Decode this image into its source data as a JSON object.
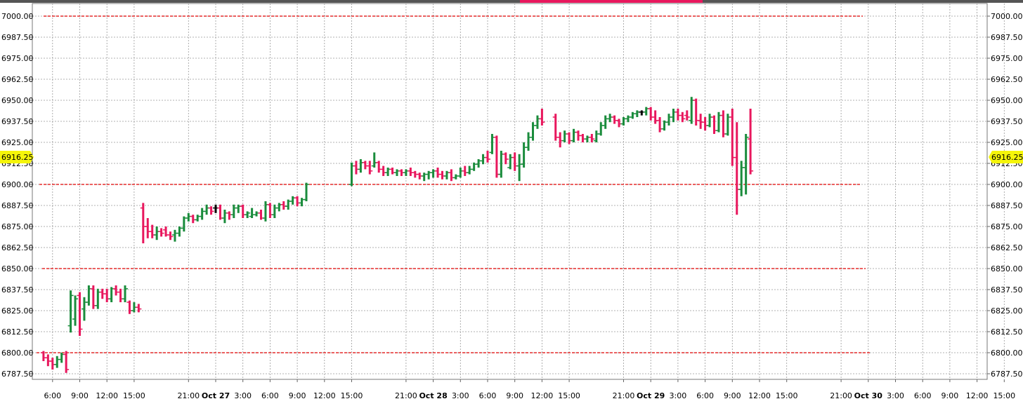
{
  "chart_data": {
    "type": "ohlc",
    "y_ticks": [
      "7000.00",
      "6987.50",
      "6975.00",
      "6962.50",
      "6950.00",
      "6937.50",
      "6925.00",
      "6912.50",
      "6900.00",
      "6887.50",
      "6875.00",
      "6862.50",
      "6850.00",
      "6837.50",
      "6825.00",
      "6812.50",
      "6800.00",
      "6787.50"
    ],
    "ylim": [
      6781,
      7004
    ],
    "x_tick_labels": [
      {
        "label": "6:00",
        "bold": false
      },
      {
        "label": "9:00",
        "bold": false
      },
      {
        "label": "12:00",
        "bold": false
      },
      {
        "label": "15:00",
        "bold": false
      },
      {
        "label": "21:00",
        "bold": false
      },
      {
        "label": "Oct 27",
        "bold": true
      },
      {
        "label": "3:00",
        "bold": false
      },
      {
        "label": "6:00",
        "bold": false
      },
      {
        "label": "9:00",
        "bold": false
      },
      {
        "label": "12:00",
        "bold": false
      },
      {
        "label": "15:00",
        "bold": false
      },
      {
        "label": "21:00",
        "bold": false
      },
      {
        "label": "Oct 28",
        "bold": true
      },
      {
        "label": "3:00",
        "bold": false
      },
      {
        "label": "6:00",
        "bold": false
      },
      {
        "label": "9:00",
        "bold": false
      },
      {
        "label": "12:00",
        "bold": false
      },
      {
        "label": "15:00",
        "bold": false
      },
      {
        "label": "21:00",
        "bold": false
      },
      {
        "label": "Oct 29",
        "bold": true
      },
      {
        "label": "3:00",
        "bold": false
      },
      {
        "label": "6:00",
        "bold": false
      },
      {
        "label": "9:00",
        "bold": false
      },
      {
        "label": "12:00",
        "bold": false
      },
      {
        "label": "15:00",
        "bold": false
      },
      {
        "label": "21:00",
        "bold": false
      },
      {
        "label": "Oct 30",
        "bold": true
      },
      {
        "label": "3:00",
        "bold": false
      },
      {
        "label": "6:00",
        "bold": false
      },
      {
        "label": "9:00",
        "bold": false
      },
      {
        "label": "12:00",
        "bold": false
      },
      {
        "label": "15:00",
        "bold": false
      }
    ],
    "current_price": "6916.25",
    "horizontal_levels": [
      7000,
      6900,
      6850,
      6800
    ],
    "grid": true,
    "colors": {
      "up": "#1a8c3c",
      "down": "#e8175d",
      "neutral": "#000000",
      "level": "#e00000",
      "price_tag": "#f5f50a",
      "grid": "#999999"
    },
    "bar_interval_hours": 0.5,
    "segments": [
      {
        "start": "Oct 26 05:00",
        "bars": [
          [
            6800,
            6801,
            6795,
            6797
          ],
          [
            6797,
            6799,
            6792,
            6795
          ],
          [
            6795,
            6797,
            6790,
            6793
          ],
          [
            6793,
            6798,
            6791,
            6796
          ],
          [
            6796,
            6800,
            6794,
            6799
          ],
          [
            6799,
            6801,
            6788,
            6790
          ],
          [
            6816,
            6837,
            6812,
            6834
          ],
          [
            6820,
            6834,
            6816,
            6832
          ],
          [
            6834,
            6836,
            6810,
            6814
          ],
          [
            6826,
            6833,
            6819,
            6830
          ],
          [
            6830,
            6840,
            6828,
            6838
          ],
          [
            6838,
            6840,
            6826,
            6828
          ],
          [
            6828,
            6838,
            6826,
            6836
          ],
          [
            6836,
            6838,
            6832,
            6835
          ],
          [
            6835,
            6838,
            6830,
            6832
          ],
          [
            6832,
            6839,
            6830,
            6838
          ],
          [
            6838,
            6840,
            6834,
            6836
          ],
          [
            6836,
            6838,
            6830,
            6832
          ],
          [
            6832,
            6840,
            6830,
            6838
          ],
          [
            6830,
            6831,
            6823,
            6825
          ],
          [
            6825,
            6830,
            6824,
            6827
          ],
          [
            6827,
            6829,
            6824,
            6826
          ]
        ]
      },
      {
        "start": "Oct 26 16:00",
        "bars": [
          [
            6886,
            6889,
            6865,
            6875
          ],
          [
            6875,
            6880,
            6868,
            6872
          ],
          [
            6872,
            6876,
            6868,
            6870
          ],
          [
            6870,
            6875,
            6867,
            6872
          ],
          [
            6872,
            6874,
            6869,
            6871
          ],
          [
            6873,
            6875,
            6869,
            6870
          ],
          [
            6870,
            6872,
            6867,
            6869
          ],
          [
            6870,
            6873,
            6866,
            6871
          ],
          [
            6871,
            6875,
            6869,
            6874
          ],
          [
            6874,
            6881,
            6872,
            6880
          ],
          [
            6880,
            6883,
            6878,
            6881
          ],
          [
            6881,
            6882,
            6877,
            6879
          ],
          [
            6879,
            6882,
            6878,
            6881
          ],
          [
            6881,
            6886,
            6879,
            6884
          ],
          [
            6884,
            6888,
            6882,
            6886
          ],
          [
            6886,
            6887,
            6882,
            6884
          ],
          [
            6886,
            6888,
            6883,
            6886
          ],
          [
            6886,
            6888,
            6879,
            6880
          ],
          [
            6880,
            6885,
            6877,
            6883
          ],
          [
            6883,
            6884,
            6879,
            6882
          ],
          [
            6882,
            6888,
            6880,
            6886
          ],
          [
            6886,
            6888,
            6883,
            6887
          ],
          [
            6887,
            6888,
            6880,
            6882
          ],
          [
            6882,
            6884,
            6880,
            6883
          ],
          [
            6881,
            6886,
            6880,
            6882
          ],
          [
            6882,
            6884,
            6881,
            6883
          ],
          [
            6883,
            6885,
            6879,
            6880
          ],
          [
            6880,
            6890,
            6878,
            6888
          ],
          [
            6888,
            6889,
            6880,
            6882
          ],
          [
            6882,
            6888,
            6880,
            6886
          ],
          [
            6886,
            6889,
            6884,
            6888
          ],
          [
            6888,
            6890,
            6885,
            6887
          ],
          [
            6887,
            6891,
            6885,
            6890
          ],
          [
            6890,
            6893,
            6888,
            6892
          ],
          [
            6892,
            6893,
            6887,
            6889
          ],
          [
            6889,
            6892,
            6887,
            6891
          ],
          [
            6891,
            6901,
            6890,
            6900
          ]
        ]
      },
      {
        "start": "Oct 27 15:00",
        "bars": [
          [
            6900,
            6913,
            6899,
            6911
          ],
          [
            6911,
            6914,
            6906,
            6909
          ],
          [
            6909,
            6915,
            6907,
            6913
          ],
          [
            6913,
            6914,
            6909,
            6911
          ],
          [
            6911,
            6914,
            6906,
            6908
          ],
          [
            6911,
            6919,
            6910,
            6913
          ],
          [
            6913,
            6914,
            6907,
            6909
          ],
          [
            6909,
            6911,
            6905,
            6907
          ],
          [
            6907,
            6910,
            6905,
            6909
          ],
          [
            6909,
            6910,
            6906,
            6907
          ],
          [
            6907,
            6909,
            6905,
            6908
          ],
          [
            6908,
            6909,
            6905,
            6907
          ],
          [
            6907,
            6909,
            6905,
            6908
          ],
          [
            6908,
            6910,
            6905,
            6907
          ],
          [
            6907,
            6908,
            6904,
            6906
          ],
          [
            6906,
            6907,
            6903,
            6905
          ],
          [
            6905,
            6907,
            6902,
            6906
          ],
          [
            6906,
            6908,
            6903,
            6907
          ],
          [
            6907,
            6909,
            6904,
            6908
          ],
          [
            6908,
            6910,
            6904,
            6906
          ],
          [
            6906,
            6908,
            6903,
            6905
          ],
          [
            6905,
            6908,
            6903,
            6907
          ],
          [
            6907,
            6909,
            6902,
            6904
          ],
          [
            6904,
            6906,
            6903,
            6905
          ],
          [
            6905,
            6910,
            6904,
            6908
          ],
          [
            6908,
            6911,
            6905,
            6907
          ],
          [
            6907,
            6911,
            6906,
            6909
          ],
          [
            6909,
            6913,
            6908,
            6912
          ],
          [
            6912,
            6915,
            6910,
            6914
          ],
          [
            6914,
            6918,
            6912,
            6916
          ],
          [
            6916,
            6920,
            6913,
            6915
          ],
          [
            6919,
            6930,
            6918,
            6928
          ],
          [
            6928,
            6929,
            6904,
            6906
          ],
          [
            6906,
            6920,
            6904,
            6918
          ],
          [
            6918,
            6919,
            6912,
            6915
          ],
          [
            6910,
            6918,
            6909,
            6916
          ],
          [
            6916,
            6919,
            6908,
            6911
          ],
          [
            6911,
            6918,
            6902,
            6912
          ],
          [
            6912,
            6925,
            6910,
            6922
          ],
          [
            6922,
            6931,
            6920,
            6928
          ],
          [
            6928,
            6937,
            6926,
            6935
          ],
          [
            6935,
            6941,
            6933,
            6939
          ],
          [
            6939,
            6945,
            6935,
            6937
          ]
        ]
      },
      {
        "start": "Oct 28 13:30",
        "bars": [
          [
            6940,
            6942,
            6926,
            6928
          ],
          [
            6928,
            6931,
            6922,
            6926
          ],
          [
            6926,
            6932,
            6925,
            6930
          ],
          [
            6930,
            6931,
            6924,
            6926
          ],
          [
            6926,
            6933,
            6925,
            6931
          ],
          [
            6931,
            6932,
            6926,
            6929
          ],
          [
            6929,
            6930,
            6925,
            6927
          ],
          [
            6927,
            6929,
            6925,
            6928
          ],
          [
            6928,
            6930,
            6925,
            6927
          ],
          [
            6926,
            6932,
            6925,
            6930
          ],
          [
            6930,
            6937,
            6929,
            6935
          ],
          [
            6935,
            6941,
            6933,
            6939
          ],
          [
            6939,
            6942,
            6937,
            6940
          ],
          [
            6940,
            6941,
            6936,
            6938
          ],
          [
            6938,
            6939,
            6934,
            6936
          ],
          [
            6936,
            6940,
            6935,
            6939
          ],
          [
            6939,
            6941,
            6937,
            6940
          ],
          [
            6940,
            6943,
            6939,
            6942
          ],
          [
            6942,
            6944,
            6940,
            6943
          ],
          [
            6943,
            6944,
            6941,
            6943
          ],
          [
            6943,
            6946,
            6941,
            6945
          ],
          [
            6945,
            6946,
            6938,
            6940
          ],
          [
            6940,
            6944,
            6936,
            6938
          ],
          [
            6938,
            6940,
            6931,
            6933
          ],
          [
            6933,
            6938,
            6932,
            6937
          ],
          [
            6937,
            6942,
            6935,
            6940
          ],
          [
            6940,
            6945,
            6937,
            6943
          ],
          [
            6943,
            6945,
            6938,
            6941
          ],
          [
            6941,
            6943,
            6937,
            6939
          ],
          [
            6941,
            6944,
            6938,
            6940
          ],
          [
            6938,
            6952,
            6936,
            6950
          ],
          [
            6950,
            6951,
            6935,
            6938
          ],
          [
            6938,
            6942,
            6933,
            6937
          ],
          [
            6937,
            6940,
            6932,
            6935
          ],
          [
            6935,
            6942,
            6934,
            6940
          ],
          [
            6940,
            6941,
            6930,
            6932
          ],
          [
            6932,
            6943,
            6931,
            6941
          ],
          [
            6941,
            6944,
            6928,
            6930
          ],
          [
            6930,
            6942,
            6929,
            6940
          ],
          [
            6940,
            6945,
            6911,
            6916
          ],
          [
            6916,
            6937,
            6882,
            6897
          ],
          [
            6897,
            6914,
            6893,
            6910
          ],
          [
            6910,
            6930,
            6894,
            6928
          ],
          [
            6927,
            6945,
            6906,
            6908
          ]
        ]
      }
    ]
  }
}
